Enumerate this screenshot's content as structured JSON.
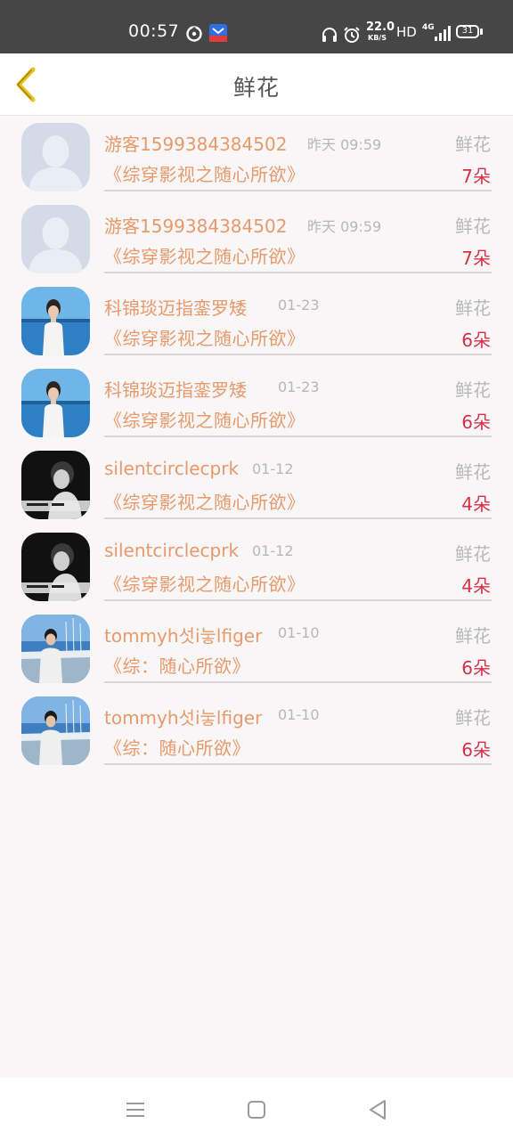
{
  "status_bar": {
    "time": "00:57",
    "speed": "22.0",
    "speed_unit": "KB/S",
    "hd": "HD",
    "network": "4G",
    "battery": "31",
    "icons": [
      "timer-icon",
      "app-notification-icon",
      "headphones-icon",
      "alarm-icon",
      "signal-icon",
      "battery-icon"
    ]
  },
  "header": {
    "title": "鲜花",
    "back_icon": "chevron-left-icon",
    "accent": "#e8c21a"
  },
  "colors": {
    "name": "#e79a6c",
    "count": "#d5304a",
    "muted": "#b7b7b7"
  },
  "items": [
    {
      "name": "游客1599384384502",
      "date": "昨天 09:59",
      "kind": "鲜花",
      "book": "《综穿影视之随心所欲》",
      "count": "7朵",
      "avatar": "default-user-avatar"
    },
    {
      "name": "游客1599384384502",
      "date": "昨天 09:59",
      "kind": "鲜花",
      "book": "《综穿影视之随心所欲》",
      "count": "7朵",
      "avatar": "default-user-avatar"
    },
    {
      "name": "科锦琰迈指銮罗矮",
      "date": "01-23",
      "kind": "鲜花",
      "book": "《综穿影视之随心所欲》",
      "count": "6朵",
      "avatar": "sea-photo-avatar"
    },
    {
      "name": "科锦琰迈指銮罗矮",
      "date": "01-23",
      "kind": "鲜花",
      "book": "《综穿影视之随心所欲》",
      "count": "6朵",
      "avatar": "sea-photo-avatar"
    },
    {
      "name": "silentcirclecprk",
      "date": "01-12",
      "kind": "鲜花",
      "book": "《综穿影视之随心所欲》",
      "count": "4朵",
      "avatar": "bw-portrait-avatar"
    },
    {
      "name": "silentcirclecprk",
      "date": "01-12",
      "kind": "鲜花",
      "book": "《综穿影视之随心所欲》",
      "count": "4朵",
      "avatar": "bw-portrait-avatar"
    },
    {
      "name": "tommyh섯i눟lfiger",
      "date": "01-10",
      "kind": "鲜花",
      "book": "《综：随心所欲》",
      "count": "6朵",
      "avatar": "harbor-photo-avatar"
    },
    {
      "name": "tommyh섯i눟lfiger",
      "date": "01-10",
      "kind": "鲜花",
      "book": "《综：随心所欲》",
      "count": "6朵",
      "avatar": "harbor-photo-avatar"
    }
  ],
  "nav": [
    "menu-icon",
    "home-square-icon",
    "back-triangle-icon"
  ]
}
